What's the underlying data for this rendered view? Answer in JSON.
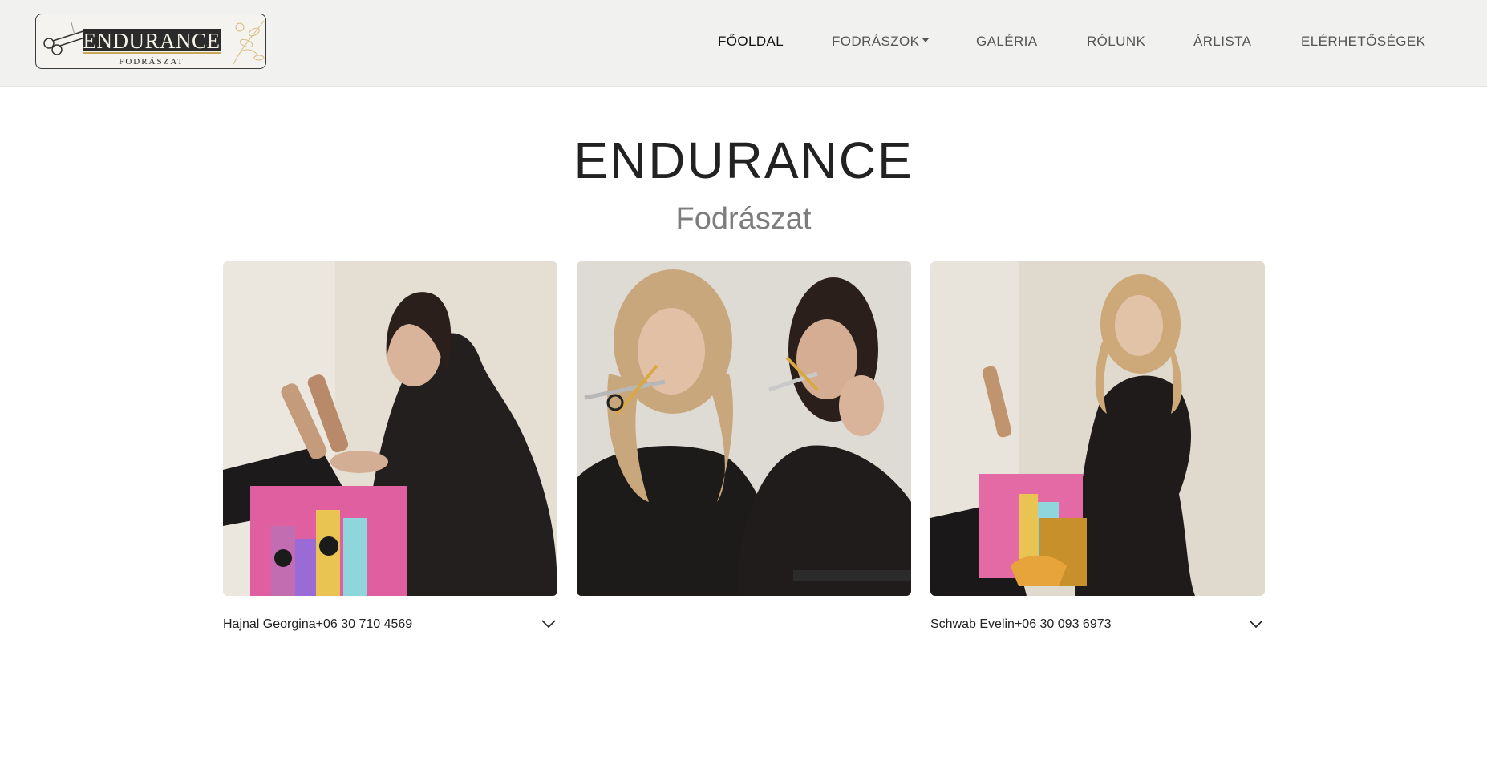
{
  "brand": {
    "logo_title": "ENDURANCE",
    "logo_subtitle": "FODRÁSZAT"
  },
  "nav": {
    "items": [
      {
        "label": "FŐOLDAL",
        "active": true
      },
      {
        "label": "FODRÁSZOK",
        "dropdown": true
      },
      {
        "label": "GALÉRIA"
      },
      {
        "label": "RÓLUNK"
      },
      {
        "label": "ÁRLISTA"
      },
      {
        "label": "ELÉRHETŐSÉGEK"
      }
    ]
  },
  "hero": {
    "title": "ENDURANCE",
    "subtitle": "Fodrászat"
  },
  "stylists": [
    {
      "caption": "Hajnal Georgina+06 30 710 4569",
      "icon": "chevron-down-icon"
    },
    {
      "caption": ""
    },
    {
      "caption": "Schwab Evelin+06 30 093 6973",
      "icon": "chevron-down-icon"
    }
  ],
  "colors": {
    "navbar_bg": "#f1f1ef",
    "logo_gold": "#caa659",
    "text_dark": "#222222",
    "text_muted": "#7d7d7d"
  }
}
